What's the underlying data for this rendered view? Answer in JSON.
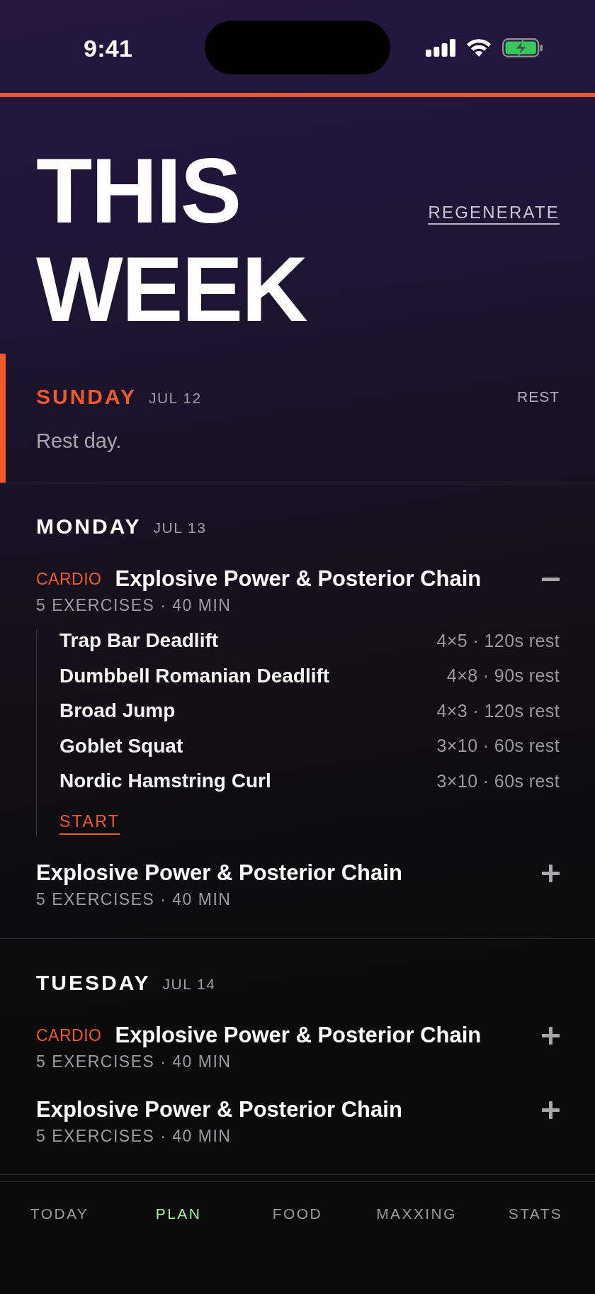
{
  "status_bar": {
    "time": "9:41"
  },
  "header": {
    "title": "THIS WEEK",
    "action": "REGENERATE"
  },
  "days": [
    {
      "name": "SUNDAY",
      "date": "JUL 12",
      "current": true,
      "status": "REST",
      "note": "Rest day."
    },
    {
      "name": "MONDAY",
      "date": "JUL 13",
      "current": false,
      "workouts": [
        {
          "tag": "CARDIO",
          "title": "Explosive Power & Posterior Chain",
          "meta": "5 EXERCISES · 40 MIN",
          "expanded": true,
          "exercises": [
            {
              "name": "Trap Bar Deadlift",
              "detail": "4×5 · 120s rest"
            },
            {
              "name": "Dumbbell Romanian Deadlift",
              "detail": "4×8 · 90s rest"
            },
            {
              "name": "Broad Jump",
              "detail": "4×3 · 120s rest"
            },
            {
              "name": "Goblet Squat",
              "detail": "3×10 · 60s rest"
            },
            {
              "name": "Nordic Hamstring Curl",
              "detail": "3×10 · 60s rest"
            }
          ],
          "action": "START"
        },
        {
          "title": "Explosive Power & Posterior Chain",
          "meta": "5 EXERCISES · 40 MIN",
          "expanded": false
        }
      ]
    },
    {
      "name": "TUESDAY",
      "date": "JUL 14",
      "current": false,
      "workouts": [
        {
          "tag": "CARDIO",
          "title": "Explosive Power & Posterior Chain",
          "meta": "5 EXERCISES · 40 MIN",
          "expanded": false
        },
        {
          "title": "Explosive Power & Posterior Chain",
          "meta": "5 EXERCISES · 40 MIN",
          "expanded": false
        }
      ]
    }
  ],
  "tab_bar": {
    "tabs": [
      {
        "label": "TODAY",
        "selected": false
      },
      {
        "label": "PLAN",
        "selected": true
      },
      {
        "label": "FOOD",
        "selected": false
      },
      {
        "label": "MAXXING",
        "selected": false
      },
      {
        "label": "STATS",
        "selected": false
      }
    ]
  }
}
